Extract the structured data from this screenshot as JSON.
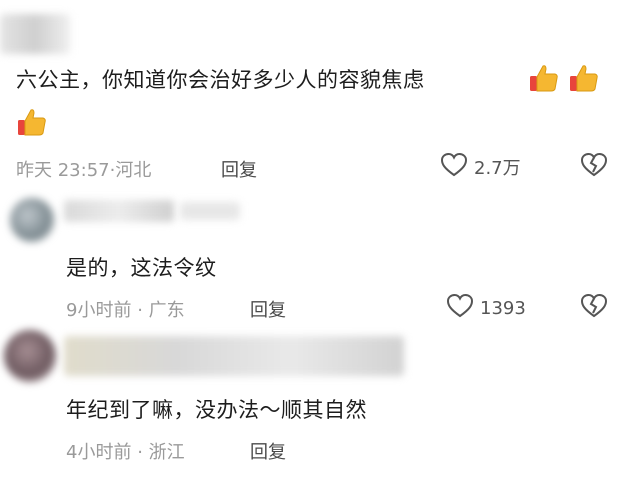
{
  "comments": [
    {
      "text": "六公主，你知道你会治好多少人的容貌焦虑",
      "time": "昨天 23:57",
      "sep": "·",
      "location": "河北",
      "reply_label": "回复",
      "likes": "2.7万",
      "emoji": "thumbs-up-emoji"
    },
    {
      "text": "是的，这法令纹",
      "time": "9小时前",
      "sep": "·",
      "location": "广东",
      "reply_label": "回复",
      "likes": "1393"
    },
    {
      "text": "年纪到了嘛，没办法～顺其自然",
      "time": "4小时前",
      "sep": "·",
      "location": "浙江",
      "reply_label": "回复"
    }
  ],
  "colors": {
    "meta": "#9a9a9a",
    "reply": "#4a4a4a",
    "thumb": "#f5b731",
    "cuff": "#e8453c"
  },
  "icons": [
    "heart-icon",
    "broken-heart-icon",
    "thumbs-up-emoji"
  ]
}
